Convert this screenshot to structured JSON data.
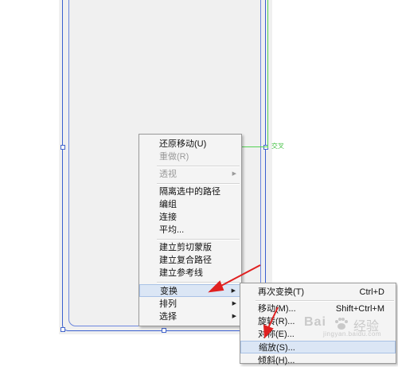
{
  "canvas": {
    "guide_label": "交叉"
  },
  "context_menu": {
    "items": [
      {
        "label": "还原移动(U)",
        "enabled": true
      },
      {
        "label": "重做(R)",
        "enabled": false
      },
      {
        "label": "透视",
        "enabled": false,
        "submenu": true
      },
      {
        "label": "隔离选中的路径",
        "enabled": true
      },
      {
        "label": "编组",
        "enabled": true
      },
      {
        "label": "连接",
        "enabled": true
      },
      {
        "label": "平均...",
        "enabled": true
      },
      {
        "label": "建立剪切蒙版",
        "enabled": true
      },
      {
        "label": "建立复合路径",
        "enabled": true
      },
      {
        "label": "建立参考线",
        "enabled": true
      },
      {
        "label": "变换",
        "enabled": true,
        "submenu": true,
        "highlighted": true
      },
      {
        "label": "排列",
        "enabled": true,
        "submenu": true
      },
      {
        "label": "选择",
        "enabled": true,
        "submenu": true
      }
    ]
  },
  "submenu": {
    "items": [
      {
        "label": "再次变换(T)",
        "shortcut": "Ctrl+D"
      },
      {
        "label": "移动(M)...",
        "shortcut": "Shift+Ctrl+M"
      },
      {
        "label": "旋转(R)...",
        "shortcut": ""
      },
      {
        "label": "对称(E)...",
        "shortcut": ""
      },
      {
        "label": "缩放(S)...",
        "shortcut": "",
        "highlighted": true
      },
      {
        "label": "倾斜(H)...",
        "shortcut": ""
      }
    ]
  },
  "watermark": {
    "logo": "Bai",
    "text": "经验",
    "url": "jingyan.baidu.com"
  },
  "colors": {
    "annotation_arrow": "#e02020",
    "guide": "#54d254",
    "selection": "#3a5fcf",
    "menu_highlight": "#dbe6f5"
  }
}
